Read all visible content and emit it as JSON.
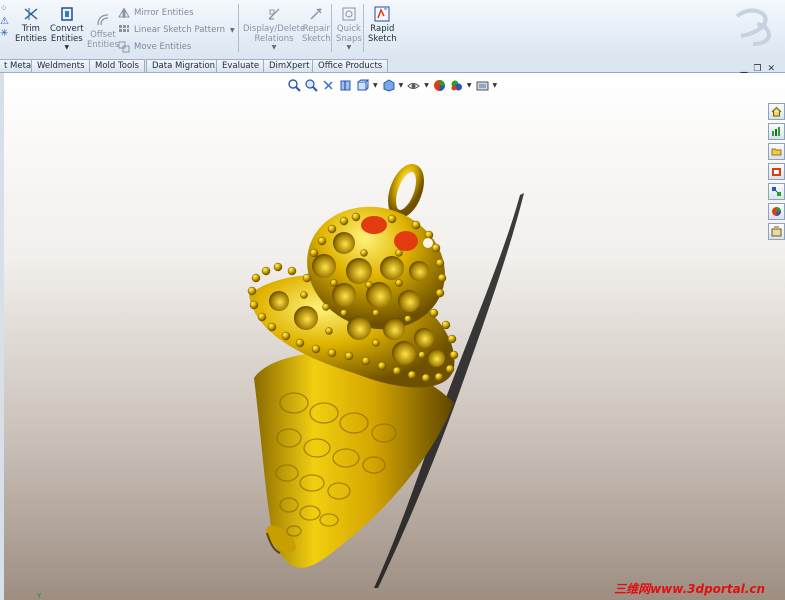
{
  "ribbon": {
    "trim": {
      "l1": "Trim",
      "l2": "Entities"
    },
    "convert": {
      "l1": "Convert",
      "l2": "Entities"
    },
    "offset": {
      "l1": "Offset",
      "l2": "Entities"
    },
    "mirror": "Mirror Entities",
    "linear": "Linear Sketch Pattern",
    "move": "Move Entities",
    "display": {
      "l1": "Display/Delete",
      "l2": "Relations"
    },
    "repair": {
      "l1": "Repair",
      "l2": "Sketch"
    },
    "quick": {
      "l1": "Quick",
      "l2": "Snaps"
    },
    "rapid": {
      "l1": "Rapid",
      "l2": "Sketch"
    }
  },
  "tabs": [
    "t Metal",
    "Weldments",
    "Mold Tools",
    "Data Migration",
    "Evaluate",
    "DimXpert",
    "Office Products"
  ],
  "watermark": "三维网www.3dportal.cn",
  "colors": {
    "gold": "#d4a500",
    "gold_dark": "#7a5c00",
    "gold_light": "#ffe34a",
    "red": "#e23b10"
  },
  "hud_icons": [
    "zoom-to-fit-icon",
    "zoom-area-icon",
    "previous-view-icon",
    "section-view-icon",
    "view-orientation-icon",
    "display-style-icon",
    "hide-show-icon",
    "edit-appearance-icon",
    "apply-scene-icon",
    "view-settings-icon"
  ],
  "taskpane_icons": [
    "home-icon",
    "resources-icon",
    "design-library-icon",
    "file-explorer-icon",
    "view-palette-icon",
    "appearances-icon",
    "custom-properties-icon"
  ]
}
